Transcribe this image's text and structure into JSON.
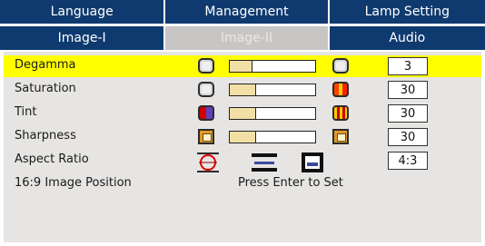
{
  "tabs_top": [
    "Language",
    "Management",
    "Lamp Setting"
  ],
  "tabs_bottom": [
    "Image-I",
    "Image-II",
    "Audio"
  ],
  "active_tab": "Image-II",
  "items": [
    {
      "label": "Degamma",
      "value": "3",
      "level": 0.0,
      "selected": true
    },
    {
      "label": "Saturation",
      "value": "30",
      "level": 0.3
    },
    {
      "label": "Tint",
      "value": "30",
      "level": 0.3
    },
    {
      "label": "Sharpness",
      "value": "30",
      "level": 0.3
    },
    {
      "label": "Aspect Ratio",
      "value": "4:3"
    },
    {
      "label": "16:9 Image Position",
      "action_text": "Press Enter to Set"
    }
  ],
  "colors": {
    "tab_bg": "#0f3a6f",
    "active_tab_bg": "#c8c6c4",
    "panel_bg": "#e6e5e3",
    "highlight": "#ffff00",
    "slider_fill": "#f2dfa6"
  }
}
